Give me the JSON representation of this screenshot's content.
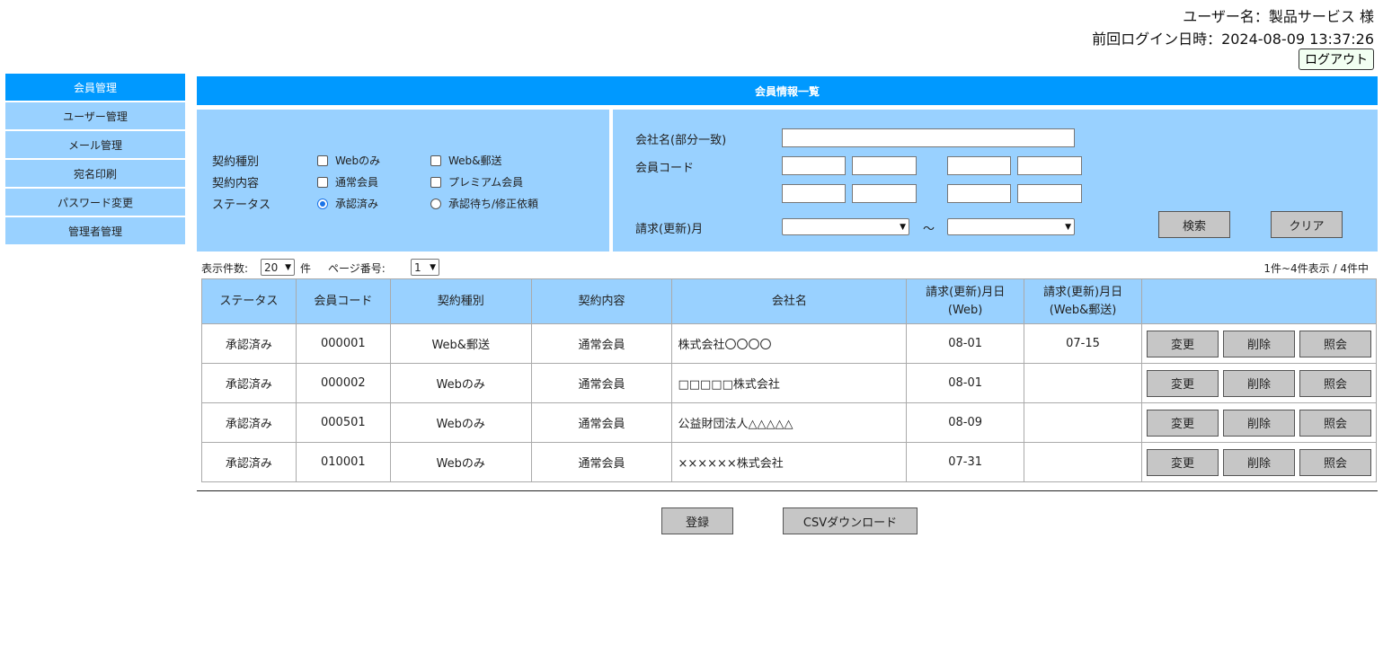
{
  "header": {
    "user_label": "ユーザー名：製品サービス 様",
    "last_login": "前回ログイン日時：2024-08-09 13:37:26",
    "logout": "ログアウト"
  },
  "sidebar": {
    "items": [
      {
        "label": "会員管理",
        "active": true
      },
      {
        "label": "ユーザー管理"
      },
      {
        "label": "メール管理"
      },
      {
        "label": "宛名印刷"
      },
      {
        "label": "パスワード変更"
      },
      {
        "label": "管理者管理"
      }
    ]
  },
  "main": {
    "title": "会員情報一覧"
  },
  "search": {
    "contract_type": {
      "label": "契約種別",
      "options": [
        "Webのみ",
        "Web&郵送"
      ]
    },
    "contract_content": {
      "label": "契約内容",
      "options": [
        "通常会員",
        "プレミアム会員"
      ]
    },
    "status": {
      "label": "ステータス",
      "options": [
        "承認済み",
        "承認待ち/修正依頼"
      ],
      "selected": "承認済み"
    },
    "company_name": {
      "label": "会社名(部分一致)",
      "value": ""
    },
    "member_code": {
      "label": "会員コード"
    },
    "billing_month": {
      "label": "請求(更新)月",
      "from": "",
      "to": "",
      "tilde": "～"
    },
    "search_button": "検索",
    "clear_button": "クリア"
  },
  "paging": {
    "per_page_label": "表示件数:",
    "per_page_value": "20",
    "per_page_unit": "件",
    "page_label": "ページ番号:",
    "page_value": "1",
    "summary": "1件~4件表示 / 4件中"
  },
  "table": {
    "headers": [
      "ステータス",
      "会員コード",
      "契約種別",
      "契約内容",
      "会社名",
      "請求(更新)月日\n(Web)",
      "請求(更新)月日\n(Web&郵送)",
      ""
    ],
    "rows": [
      {
        "status": "承認済み",
        "code": "000001",
        "type": "Web&郵送",
        "content": "通常会員",
        "company": "株式会社〇〇〇〇",
        "web": "08-01",
        "post": "07-15"
      },
      {
        "status": "承認済み",
        "code": "000002",
        "type": "Webのみ",
        "content": "通常会員",
        "company": "□□□□□株式会社",
        "web": "08-01",
        "post": ""
      },
      {
        "status": "承認済み",
        "code": "000501",
        "type": "Webのみ",
        "content": "通常会員",
        "company": "公益財団法人△△△△△",
        "web": "08-09",
        "post": ""
      },
      {
        "status": "承認済み",
        "code": "010001",
        "type": "Webのみ",
        "content": "通常会員",
        "company": "××××××株式会社",
        "web": "07-31",
        "post": ""
      }
    ],
    "actions": {
      "edit": "変更",
      "delete": "削除",
      "view": "照会"
    }
  },
  "footer": {
    "register": "登録",
    "csv": "CSVダウンロード"
  },
  "colors": {
    "accent": "#0099ff",
    "panel": "#99d1ff",
    "button": "#c6c6c6"
  }
}
